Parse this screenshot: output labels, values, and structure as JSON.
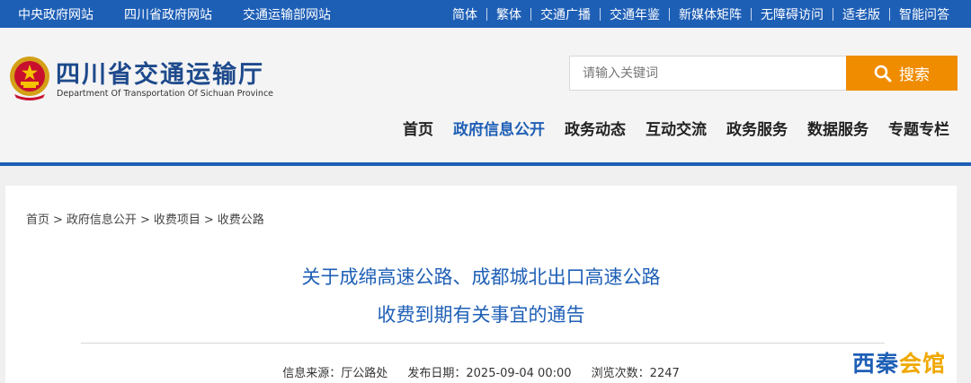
{
  "topbar": {
    "left_links": [
      "中央政府网站",
      "四川省政府网站",
      "交通运输部网站"
    ],
    "right_links": [
      "简体",
      "繁体",
      "交通广播",
      "交通年鉴",
      "新媒体矩阵",
      "无障碍访问",
      "适老版",
      "智能问答"
    ]
  },
  "header": {
    "site_name": "四川省交通运输厅",
    "site_name_en": "Department Of Transportation Of Sichuan Province",
    "search_placeholder": "请输入关键词",
    "search_button": "搜索",
    "nav": [
      "首页",
      "政府信息公开",
      "政务动态",
      "互动交流",
      "政务服务",
      "数据服务",
      "专题专栏"
    ],
    "active_nav": "政府信息公开"
  },
  "breadcrumb": [
    "首页",
    "政府信息公开",
    "收费项目",
    "收费公路"
  ],
  "article": {
    "title_line1": "关于成绵高速公路、成都城北出口高速公路",
    "title_line2": "收费到期有关事宜的通告",
    "source": "信息来源：厅公路处",
    "date": "发布日期：2025-09-04 00:00",
    "views": "浏览次数：2247"
  },
  "watermark": {
    "part1": "西秦",
    "part2": "会馆"
  },
  "colors": {
    "primary_blue": "#1e5fb6",
    "search_orange": "#f08c00"
  }
}
